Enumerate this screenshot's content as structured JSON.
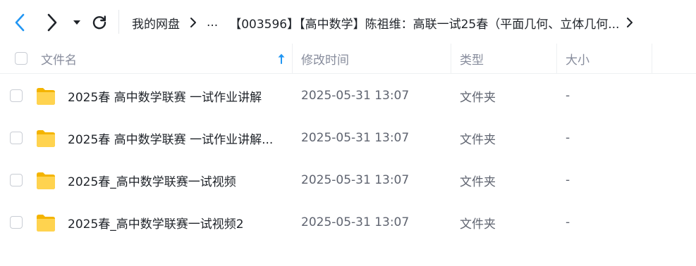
{
  "toolbar": {
    "back_icon": "chevron-left-icon",
    "forward_icon": "chevron-right-icon",
    "history_icon": "caret-down-icon",
    "refresh_icon": "refresh-icon",
    "accent_color": "#2196f3"
  },
  "breadcrumb": {
    "root": "我的网盘",
    "ellipsis": "...",
    "current": "【003596】【高中数学】陈祖维：高联一试25春（平面几何、立体几何..."
  },
  "table": {
    "columns": [
      "文件名",
      "修改时间",
      "类型",
      "大小"
    ],
    "sort_icon": "sort-ascending-arrow-icon",
    "rows": [
      {
        "name": "2025春 高中数学联赛 一试作业讲解",
        "modified": "2025-05-31 13:07",
        "type": "文件夹",
        "size": "-"
      },
      {
        "name": "2025春 高中数学联赛 一试作业讲解...",
        "modified": "2025-05-31 13:07",
        "type": "文件夹",
        "size": "-"
      },
      {
        "name": "2025春_高中数学联赛一试视频",
        "modified": "2025-05-31 13:07",
        "type": "文件夹",
        "size": "-"
      },
      {
        "name": "2025春_高中数学联赛一试视频2",
        "modified": "2025-05-31 13:07",
        "type": "文件夹",
        "size": "-"
      }
    ]
  }
}
